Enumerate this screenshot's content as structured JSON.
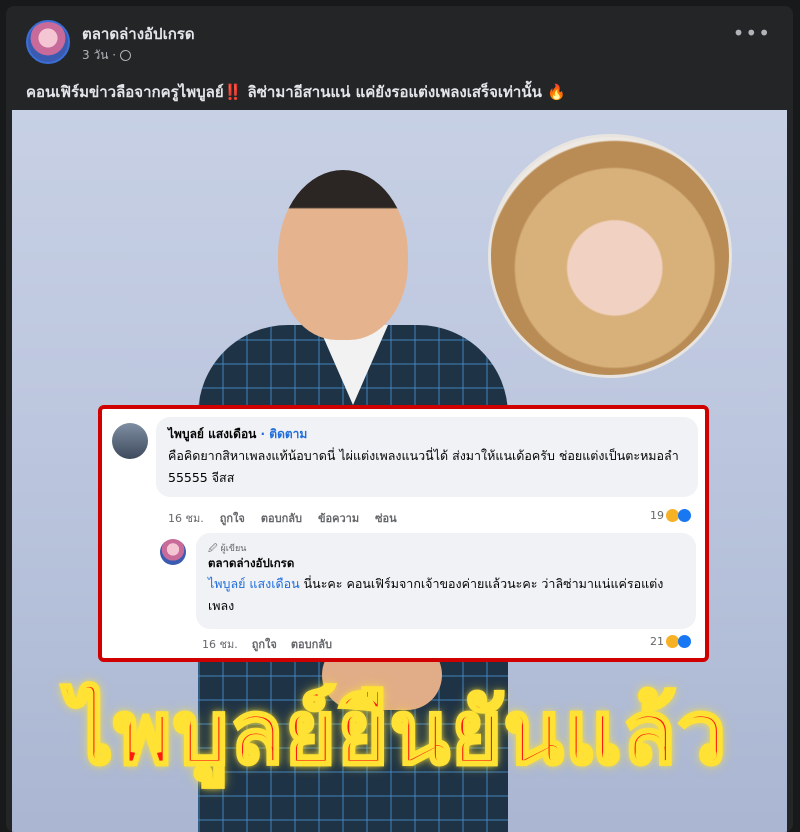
{
  "post": {
    "page_name": "ตลาดล่างอัปเกรด",
    "time": "3 วัน ·",
    "caption_main": "คอนเฟิร์มข่าวลือจากครูไพบูลย์",
    "caption_bang": "‼️",
    "caption_rest": "  ลิซ่ามาอีสานแน่ แค่ยังรอแต่งเพลงเสร็จเท่านั้น",
    "caption_fire": "🔥",
    "more_icon": "•••"
  },
  "image": {
    "comment1": {
      "name": "ไพบูลย์ แสงเดือน",
      "follow": " · ติดตาม",
      "text": "คือคิดยากสิหาเพลงแท้น้อบาดนี่ ไผ่แต่งเพลงแนวนี่ได้ ส่งมาให้แนเด้อครับ ช่อยแต่งเป็นตะหมอลำ 55555 จีสส",
      "time": "16 ชม.",
      "like": "ถูกใจ",
      "reply": "ตอบกลับ",
      "message": "ข้อความ",
      "hide": "ซ่อน",
      "reactions": "19"
    },
    "comment2": {
      "badge": "🖉 ผู้เขียน",
      "name": "ตลาดล่างอัปเกรด",
      "mention": "ไพบูลย์ แสงเดือน",
      "text": " นี่นะคะ คอนเฟิร์มจากเจ้าของค่ายแล้วนะคะ ว่าลิซ่ามาแน่แค่รอแต่งเพลง",
      "time": "16 ชม.",
      "like": "ถูกใจ",
      "reply": "ตอบกลับ",
      "reactions": "21"
    },
    "headline": "ไพบูลย์ยืนยันแล้ว"
  }
}
